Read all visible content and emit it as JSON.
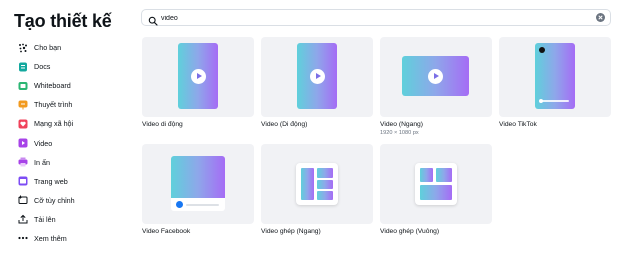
{
  "sidebar": {
    "title": "Tạo thiết kế",
    "items": [
      {
        "label": "Cho bạn",
        "icon": "sparkle-icon",
        "color": "#0e1318"
      },
      {
        "label": "Docs",
        "icon": "docs-icon",
        "color": "#13a89e"
      },
      {
        "label": "Whiteboard",
        "icon": "whiteboard-icon",
        "color": "#2bb673"
      },
      {
        "label": "Thuyết trình",
        "icon": "presentation-icon",
        "color": "#f29a1f"
      },
      {
        "label": "Mạng xã hội",
        "icon": "heart-icon",
        "color": "#f0425a"
      },
      {
        "label": "Video",
        "icon": "video-icon",
        "color": "#a743e8"
      },
      {
        "label": "In ấn",
        "icon": "print-icon",
        "color": "#a743e8"
      },
      {
        "label": "Trang web",
        "icon": "website-icon",
        "color": "#7d4cf4"
      },
      {
        "label": "Cỡ tùy chỉnh",
        "icon": "custom-size-icon",
        "color": "#0e1318"
      },
      {
        "label": "Tải lên",
        "icon": "upload-icon",
        "color": "#0e1318"
      },
      {
        "label": "Xem thêm",
        "icon": "more-icon",
        "color": "#0e1318"
      }
    ]
  },
  "search": {
    "value": "video",
    "icon": "search-icon",
    "clear_icon": "close-icon"
  },
  "results": [
    {
      "label": "Video di động",
      "sub": "",
      "thumb": "portrait"
    },
    {
      "label": "Video (Di động)",
      "sub": "",
      "thumb": "portrait"
    },
    {
      "label": "Video (Ngang)",
      "sub": "1920 × 1080 px",
      "thumb": "landscape"
    },
    {
      "label": "Video TikTok",
      "sub": "",
      "thumb": "tiktok"
    },
    {
      "label": "Video Facebook",
      "sub": "",
      "thumb": "facebook"
    },
    {
      "label": "Video ghép (Ngang)",
      "sub": "",
      "thumb": "collage"
    },
    {
      "label": "Video ghép (Vuông)",
      "sub": "",
      "thumb": "collage"
    }
  ],
  "colors": {
    "thumb_bg": "#f1f2f5",
    "gradient_start": "#5fd0db",
    "gradient_end": "#a56cf5",
    "facebook_blue": "#1877f2"
  }
}
